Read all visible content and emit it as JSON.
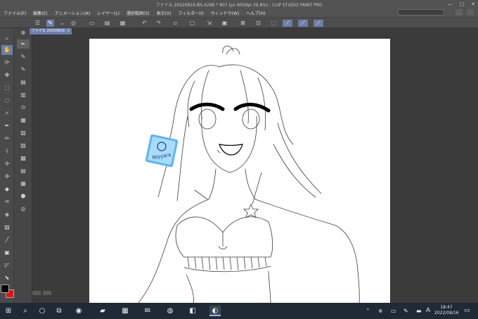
{
  "window": {
    "title": "ファイル 20220816-BS-4288 * 807 (px 600dpi 39.8%) - CLIP STUDIO PAINT PRO",
    "controls": [
      "—",
      "▢",
      "✕"
    ]
  },
  "menu": {
    "items": [
      "ファイル(F)",
      "編集(E)",
      "アニメーション(A)",
      "レイヤー(L)",
      "選択範囲(S)",
      "表示(V)",
      "フィルター(I)",
      "ウィンドウ(W)",
      "ヘルプ(H)"
    ]
  },
  "canvas": {
    "tab_label": "ファイル 20220816",
    "tab_close": "×"
  },
  "sticker": {
    "text": "Niyyara"
  },
  "colors": {
    "main": "#000000",
    "sub": "#e01010",
    "accent": "#6d7eab"
  },
  "taskbar": {
    "time": "18:47",
    "date": "2022/09/16",
    "ime": "A"
  }
}
